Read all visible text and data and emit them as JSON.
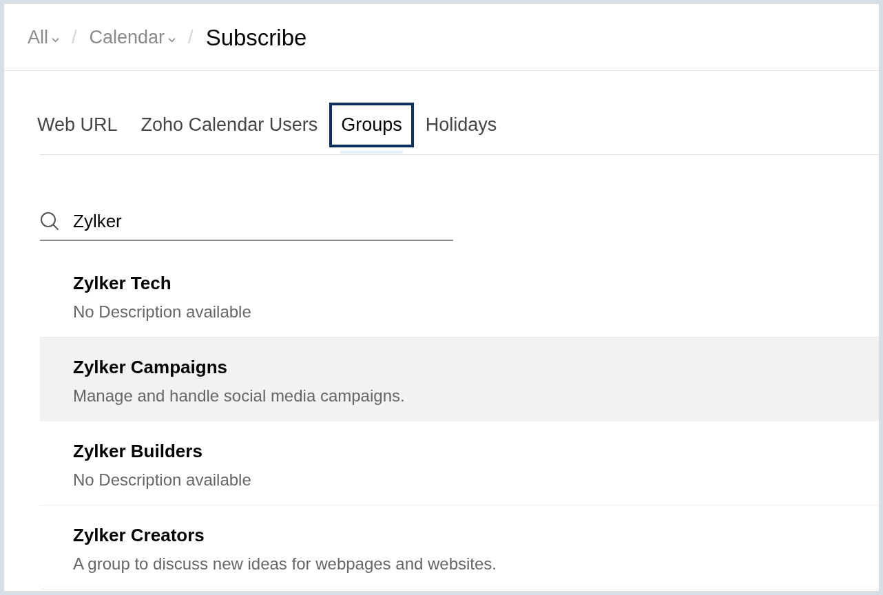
{
  "breadcrumb": [
    {
      "kind": "dropdown",
      "label": "All"
    },
    {
      "kind": "separator",
      "label": "/"
    },
    {
      "kind": "dropdown",
      "label": "Calendar"
    },
    {
      "kind": "separator",
      "label": "/"
    },
    {
      "kind": "current",
      "label": "Subscribe"
    }
  ],
  "tabs": [
    {
      "label": "Web URL",
      "selected": false
    },
    {
      "label": "Zoho Calendar Users",
      "selected": false
    },
    {
      "label": "Groups",
      "selected": true
    },
    {
      "label": "Holidays",
      "selected": false
    }
  ],
  "search": {
    "value": "Zylker"
  },
  "groups": [
    {
      "name": "Zylker Tech",
      "description": "No Description available",
      "selected": false
    },
    {
      "name": "Zylker Campaigns",
      "description": "Manage and handle social media campaigns.",
      "selected": true
    },
    {
      "name": "Zylker Builders",
      "description": "No Description available",
      "selected": false
    },
    {
      "name": "Zylker Creators",
      "description": "A group to discuss new ideas for webpages and websites.",
      "selected": false
    }
  ]
}
